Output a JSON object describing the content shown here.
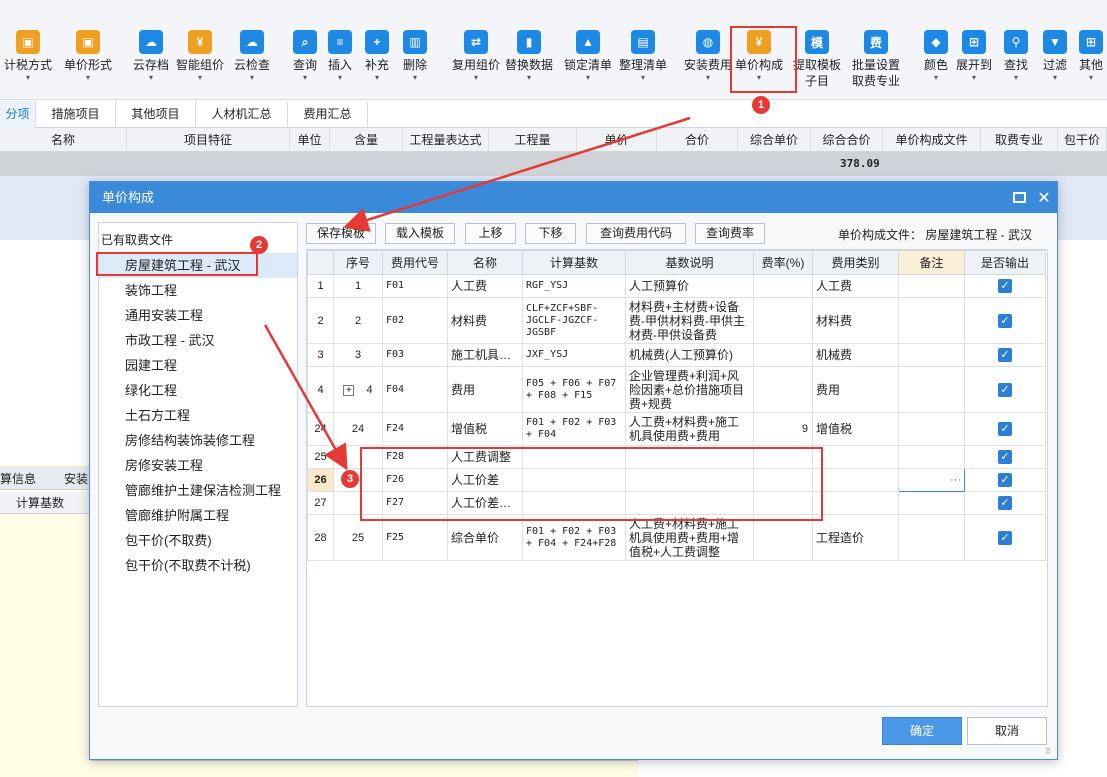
{
  "toolbar": {
    "buttons": [
      {
        "label": "计税方式",
        "icon": "tax-icon",
        "color": "#f0a020"
      },
      {
        "label": "单价形式",
        "icon": "price-form-icon",
        "color": "#f0a020"
      },
      {
        "label": "云存档",
        "icon": "cloud-save-icon",
        "color": "#1e88e5"
      },
      {
        "label": "智能组价",
        "icon": "smart-price-icon",
        "color": "#f0a020"
      },
      {
        "label": "云检查",
        "icon": "cloud-check-icon",
        "color": "#1e88e5"
      },
      {
        "label": "查询",
        "icon": "query-icon",
        "color": "#1e88e5"
      },
      {
        "label": "插入",
        "icon": "insert-icon",
        "color": "#1e88e5"
      },
      {
        "label": "补充",
        "icon": "supplement-icon",
        "color": "#1e88e5"
      },
      {
        "label": "删除",
        "icon": "delete-icon",
        "color": "#1e88e5"
      },
      {
        "label": "复用组价",
        "icon": "reuse-price-icon",
        "color": "#1e88e5"
      },
      {
        "label": "替换数据",
        "icon": "replace-data-icon",
        "color": "#1e88e5"
      },
      {
        "label": "锁定清单",
        "icon": "lock-list-icon",
        "color": "#1e88e5"
      },
      {
        "label": "整理清单",
        "icon": "organize-list-icon",
        "color": "#1e88e5"
      },
      {
        "label": "安装费用",
        "icon": "install-fee-icon",
        "color": "#1e88e5"
      },
      {
        "label": "单价构成",
        "icon": "unit-price-composition-icon",
        "color": "#f0a020"
      },
      {
        "label": "提取模板",
        "label2": "子目",
        "icon": "extract-template-icon",
        "color": "#1e88e5",
        "glyph": "模"
      },
      {
        "label": "批量设置",
        "label2": "取费专业",
        "icon": "batch-set-fee-icon",
        "color": "#1e88e5",
        "glyph": "费"
      },
      {
        "label": "颜色",
        "icon": "color-icon",
        "color": "#1e88e5"
      },
      {
        "label": "展开到",
        "icon": "expand-to-icon",
        "color": "#1e88e5"
      },
      {
        "label": "查找",
        "icon": "find-icon",
        "color": "#1e88e5"
      },
      {
        "label": "过滤",
        "icon": "filter-icon",
        "color": "#1e88e5"
      },
      {
        "label": "其他",
        "icon": "other-icon",
        "color": "#1e88e5"
      }
    ]
  },
  "tabs": [
    "分项",
    "措施项目",
    "其他项目",
    "人材机汇总",
    "费用汇总"
  ],
  "background_grid": {
    "headers": [
      "名称",
      "项目特征",
      "单位",
      "含量",
      "工程量表达式",
      "工程量",
      "单价",
      "合价",
      "综合单价",
      "综合合价",
      "单价构成文件",
      "取费专业",
      "包干价"
    ],
    "total_value": "378.09",
    "lower_tabs": [
      "算信息",
      "安装"
    ],
    "lower_header": "计算基数"
  },
  "dialog": {
    "title": "单价构成",
    "left_title": "已有取费文件",
    "files": [
      "房屋建筑工程 - 武汉",
      "装饰工程",
      "通用安装工程",
      "市政工程 - 武汉",
      "园建工程",
      "绿化工程",
      "土石方工程",
      "房修结构装饰装修工程",
      "房修安装工程",
      "管廊维护土建保洁检测工程",
      "管廊维护附属工程",
      "包干价(不取费)",
      "包干价(不取费不计税)"
    ],
    "buttons": {
      "save_template": "保存模板",
      "load_template": "载入模板",
      "move_up": "上移",
      "move_down": "下移",
      "query_code": "查询费用代码",
      "query_rate": "查询费率"
    },
    "file_label": "单价构成文件： 房屋建筑工程 - 武汉",
    "columns": [
      "",
      "序号",
      "费用代号",
      "名称",
      "计算基数",
      "基数说明",
      "费率(%)",
      "费用类别",
      "备注",
      "是否输出"
    ],
    "rows": [
      {
        "row": "1",
        "seq": "1",
        "code": "F01",
        "name": "人工费",
        "base": "RGF_YSJ",
        "desc": "人工预算价",
        "rate": "",
        "type": "人工费",
        "note": "",
        "output": true
      },
      {
        "row": "2",
        "seq": "2",
        "code": "F02",
        "name": "材料费",
        "base": "CLF+ZCF+SBF-JGCLF-JGZCF-JGSBF",
        "desc": "材料费+主材费+设备费-甲供材料费-甲供主材费-甲供设备费",
        "rate": "",
        "type": "材料费",
        "note": "",
        "output": true
      },
      {
        "row": "3",
        "seq": "3",
        "code": "F03",
        "name": "施工机具…",
        "base": "JXF_YSJ",
        "desc": "机械费(人工预算价)",
        "rate": "",
        "type": "机械费",
        "note": "",
        "output": true
      },
      {
        "row": "4",
        "seq": "4",
        "code": "F04",
        "name": "费用",
        "base": "F05 + F06 + F07 + F08 + F15",
        "desc": "企业管理费+利润+风险因素+总价措施项目费+规费",
        "rate": "",
        "type": "费用",
        "note": "",
        "output": true,
        "expander": "+"
      },
      {
        "row": "24",
        "seq": "24",
        "code": "F24",
        "name": "增值税",
        "base": "F01 + F02 + F03 + F04",
        "desc": "人工费+材料费+施工机具使用费+费用",
        "rate": "9",
        "type": "增值税",
        "note": "",
        "output": true
      },
      {
        "row": "25",
        "seq": "",
        "code": "F28",
        "name": "人工费调整",
        "base": "",
        "desc": "",
        "rate": "",
        "type": "",
        "note": "",
        "output": true
      },
      {
        "row": "26",
        "seq": "",
        "code": "F26",
        "name": "人工价差",
        "base": "",
        "desc": "",
        "rate": "",
        "type": "",
        "note": "···",
        "output": true,
        "current": true
      },
      {
        "row": "27",
        "seq": "",
        "code": "F27",
        "name": "人工价差…",
        "base": "",
        "desc": "",
        "rate": "",
        "type": "",
        "note": "",
        "output": true
      },
      {
        "row": "28",
        "seq": "25",
        "code": "F25",
        "name": "综合单价",
        "base": "F01 + F02 + F03 + F04 + F24+F28",
        "desc": "人工费+材料费+施工机具使用费+费用+增值税+人工费调整",
        "rate": "",
        "type": "工程造价",
        "note": "",
        "output": true
      }
    ],
    "ok": "确定",
    "cancel": "取消"
  },
  "annotations": {
    "badges": [
      "1",
      "2",
      "3"
    ],
    "color": "#e53935"
  }
}
